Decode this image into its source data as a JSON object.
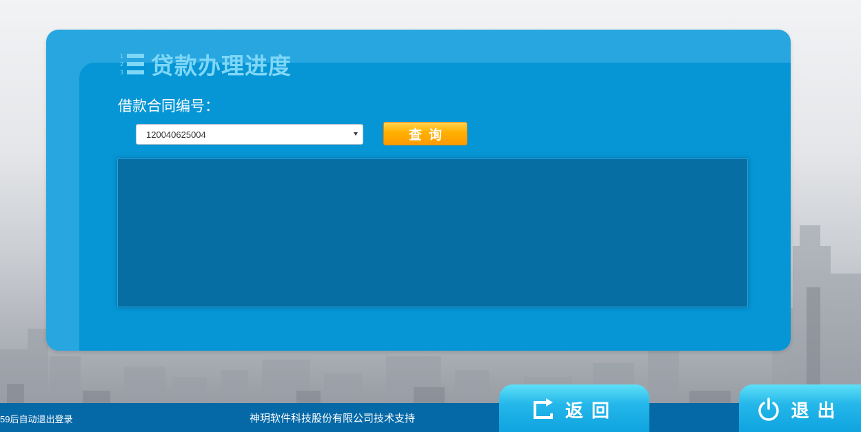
{
  "header": {
    "title": "贷款办理进度",
    "icon": "numbered-list-icon"
  },
  "form": {
    "contract_label": "借款合同编号：",
    "contract_value": "120040625004",
    "query_label": "查询"
  },
  "footer": {
    "countdown_text": "59后自动退出登录",
    "support_text": "神玥软件科技股份有限公司技术支持"
  },
  "nav": {
    "back_label": "返回",
    "exit_label": "退出"
  },
  "colors": {
    "panel": "#27a6df",
    "panel_inner": "#0696d6",
    "result_area": "#066ea3",
    "accent_button": "#ffb000",
    "footer": "#0569a8"
  }
}
